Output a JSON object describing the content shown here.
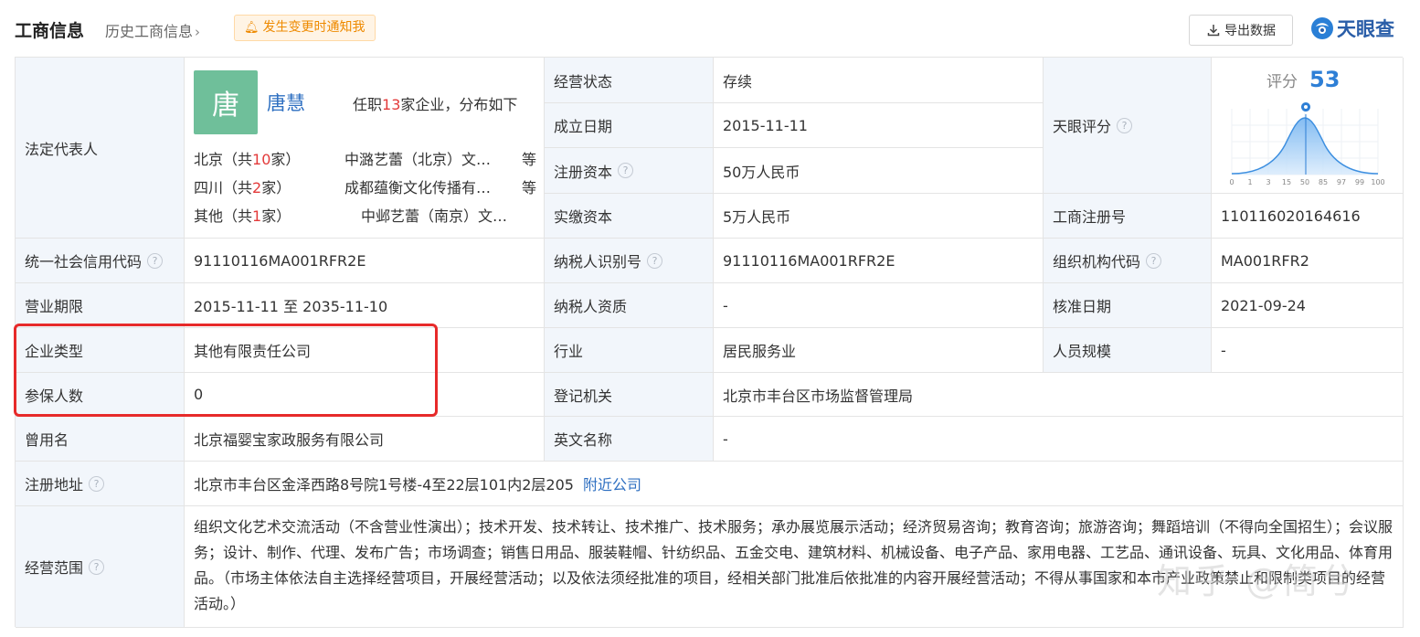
{
  "header": {
    "title": "工商信息",
    "history": "历史工商信息",
    "notify": "发生变更时通知我",
    "export": "导出数据",
    "logo": "天眼查",
    "icons": {
      "bell": "bell-icon",
      "download": "download-icon",
      "logo": "tianyancha-logo-icon",
      "history": "chevron-right-icon"
    }
  },
  "legal": {
    "label": "法定代表人",
    "avatar": "唐",
    "name": "唐慧",
    "posts_prefix": "任职",
    "posts_count": "13",
    "posts_suffix": "家企业，分布如下",
    "regions": [
      {
        "pre": "北京（共",
        "num": "10",
        "post": "家）",
        "company": "中潞艺蕾（北京）文…",
        "etc": "等"
      },
      {
        "pre": "四川（共",
        "num": "2",
        "post": "家）",
        "company": "成都蕴衡文化传播有…",
        "etc": "等"
      },
      {
        "pre": "其他（共",
        "num": "1",
        "post": "家）",
        "company": "中邺艺蕾（南京）文…",
        "etc": ""
      }
    ]
  },
  "fields": {
    "status_label": "经营状态",
    "status": "存续",
    "founded_label": "成立日期",
    "founded": "2015-11-11",
    "capital_label": "注册资本",
    "capital": "50万人民币",
    "paid_label": "实缴资本",
    "paid": "5万人民币",
    "score_label": "天眼评分",
    "regno_label": "工商注册号",
    "regno": "110116020164616",
    "credit_label": "统一社会信用代码",
    "credit": "91110116MA001RFR2E",
    "taxid_label": "纳税人识别号",
    "taxid": "91110116MA001RFR2E",
    "org_label": "组织机构代码",
    "org": "MA001RFR2",
    "term_label": "营业期限",
    "term": "2015-11-11 至 2035-11-10",
    "taxq_label": "纳税人资质",
    "taxq": "-",
    "approve_label": "核准日期",
    "approve": "2021-09-24",
    "type_label": "企业类型",
    "type": "其他有限责任公司",
    "industry_label": "行业",
    "industry": "居民服务业",
    "staff_label": "人员规模",
    "staff": "-",
    "insured_label": "参保人数",
    "insured": "0",
    "authority_label": "登记机关",
    "authority": "北京市丰台区市场监督管理局",
    "former_label": "曾用名",
    "former": "北京福婴宝家政服务有限公司",
    "en_label": "英文名称",
    "en": "-",
    "addr_label": "注册地址",
    "addr": "北京市丰台区金泽西路8号院1号楼-4至22层101内2层205",
    "nearby": "附近公司",
    "scope_label": "经营范围",
    "scope": "组织文化艺术交流活动（不含营业性演出）；技术开发、技术转让、技术推广、技术服务；承办展览展示活动；经济贸易咨询；教育咨询；旅游咨询；舞蹈培训（不得向全国招生）；会议服务；设计、制作、代理、发布广告；市场调查；销售日用品、服装鞋帽、针纺织品、五金交电、建筑材料、机械设备、电子产品、家用电器、工艺品、通讯设备、玩具、文化用品、体育用品。（市场主体依法自主选择经营项目，开展经营活动；以及依法须经批准的项目，经相关部门批准后依批准的内容开展经营活动；不得从事国家和本市产业政策禁止和限制类项目的经营活动。）"
  },
  "score": {
    "label": "评分",
    "value": "53",
    "ticks": [
      "0",
      "1",
      "3",
      "15",
      "50",
      "85",
      "97",
      "99",
      "100"
    ],
    "accent": "#2e7fd6"
  },
  "watermark": "知乎 @简兮",
  "colors": {
    "label_bg": "#f2f6fb",
    "link": "#2e6fc1",
    "highlight": "#e72a2a",
    "count": "#e33a3a"
  }
}
